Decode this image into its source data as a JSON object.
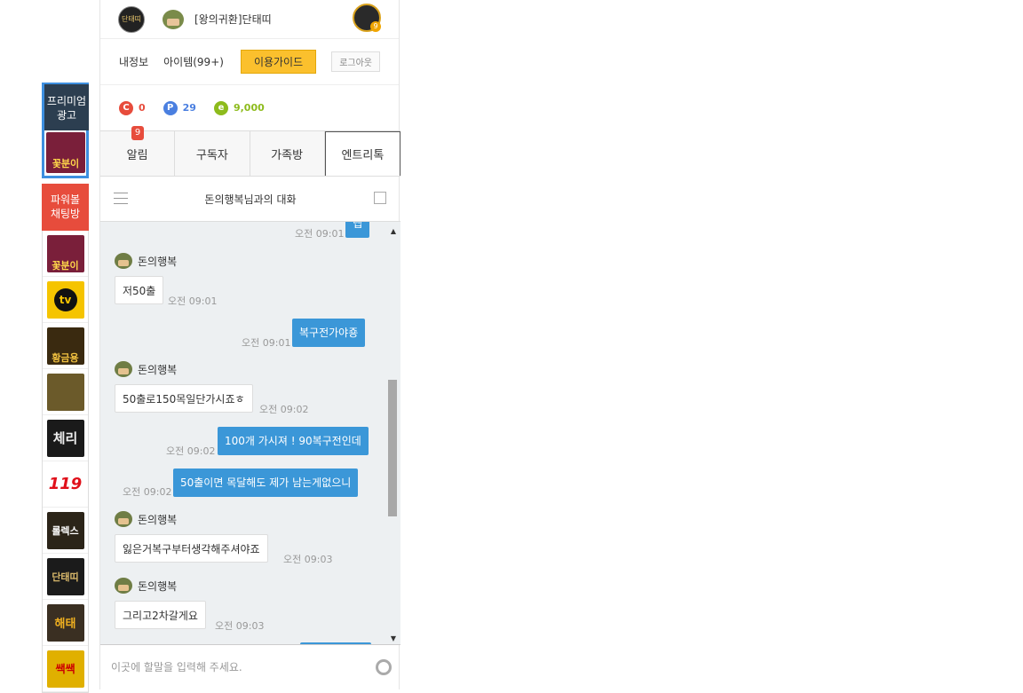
{
  "rail": {
    "premium_line1": "프리미엄",
    "premium_line2": "광고",
    "premium_thumb": "꽃분이",
    "powerball_line1": "파워볼",
    "powerball_line2": "채팅방",
    "items": [
      {
        "label": "꽃분이",
        "color": "#7a1f3a"
      },
      {
        "label": "tv",
        "color": "#f5c400"
      },
      {
        "label": "황금용",
        "color": "#3a2a10"
      },
      {
        "label": "",
        "color": "#6b5a2a"
      },
      {
        "label": "체리",
        "color": "#1a1a1a"
      },
      {
        "label": "119",
        "color": "#ffffff"
      },
      {
        "label": "롤렉스",
        "color": "#2b2418"
      },
      {
        "label": "단태띠",
        "color": "#1b1b1b"
      },
      {
        "label": "해태",
        "color": "#3a2f22"
      },
      {
        "label": "쌕쌕",
        "color": "#e0b000"
      }
    ]
  },
  "user": {
    "logo_text": "단태띠",
    "nickname": "[왕의귀환]단태띠",
    "level": "9"
  },
  "menu": {
    "my_info": "내정보",
    "items": "아이템(99+)",
    "guide": "이용가이드",
    "logout": "로그아웃"
  },
  "points": {
    "c_icon": "C",
    "c_value": "0",
    "c_color": "#e74c3c",
    "p_icon": "P",
    "p_value": "29",
    "p_color": "#4a7fe0",
    "e_icon": "e",
    "e_value": "9,000",
    "e_color": "#8dbb1c"
  },
  "tabs": {
    "alarm": "알림",
    "alarm_badge": "9",
    "subscribers": "구독자",
    "family": "가족방",
    "entry_talk": "엔트리톡"
  },
  "chat": {
    "title": "돈의행복님과의 대화",
    "input_placeholder": "이곳에 할말을 입력해 주세요.",
    "messages": [
      {
        "dir": "out",
        "text": "넵",
        "time": "오전 09:01"
      },
      {
        "dir": "in",
        "sender": "돈의행복",
        "text": "저50출",
        "time": "오전 09:01"
      },
      {
        "dir": "out",
        "text": "복구전가야죵",
        "time": "오전 09:01"
      },
      {
        "dir": "in",
        "sender": "돈의행복",
        "text": "50출로150목일단가시죠ㅎ",
        "time": "오전 09:02"
      },
      {
        "dir": "out",
        "text": "100개 가시져 ! 90복구전인데",
        "time": "오전 09:02"
      },
      {
        "dir": "out",
        "text": "50출이면 목달해도 제가 남는게없으니",
        "time": "오전 09:02"
      },
      {
        "dir": "in",
        "sender": "돈의행복",
        "text": "잃은거복구부터생각해주셔야죠",
        "time": "오전 09:03"
      },
      {
        "dir": "in",
        "sender": "돈의행복",
        "text": "그리고2차갈게요",
        "time": "오전 09:03"
      }
    ]
  }
}
